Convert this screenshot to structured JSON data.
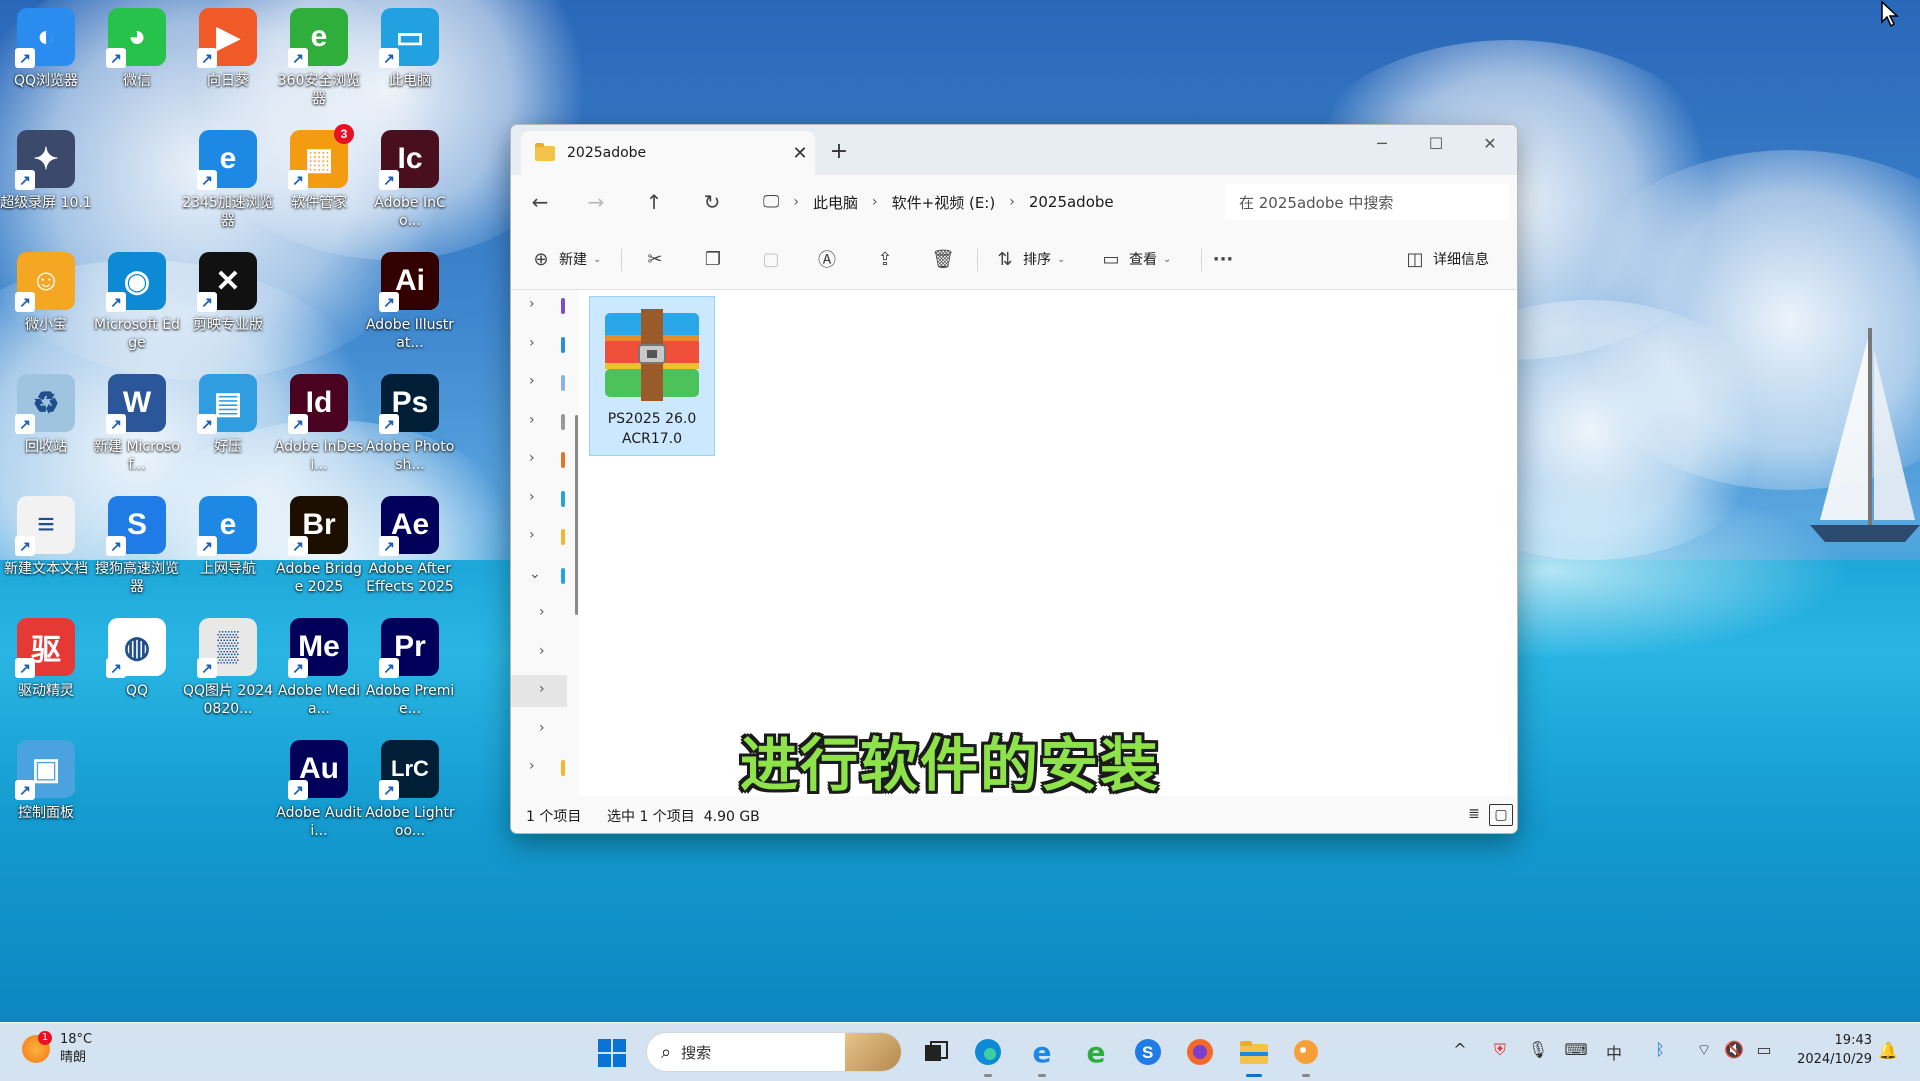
{
  "desktop": {
    "icons": [
      {
        "id": "qq-browser",
        "label": "QQ浏览器",
        "color": "#2b8cf0",
        "glyph": "◐",
        "badge": ""
      },
      {
        "id": "wechat",
        "label": "微信",
        "color": "#27c24c",
        "glyph": "◕",
        "badge": ""
      },
      {
        "id": "sunlogin",
        "label": "向日葵",
        "color": "#f05a28",
        "glyph": "▶",
        "badge": ""
      },
      {
        "id": "360-browser",
        "label": "360安全浏览器",
        "color": "#2fae3c",
        "glyph": "e",
        "badge": ""
      },
      {
        "id": "this-pc",
        "label": "此电脑",
        "color": "#21a1e0",
        "glyph": "▭",
        "badge": ""
      },
      {
        "id": "screen-recorder",
        "label": "超级录屏 10.1",
        "color": "#3b4a6b",
        "glyph": "✦",
        "badge": ""
      },
      {
        "id": "2345-browser",
        "label": "2345加速浏览器",
        "color": "#1e88e5",
        "glyph": "e",
        "badge": ""
      },
      {
        "id": "soft-manager",
        "label": "软件管家",
        "color": "#f39c12",
        "glyph": "▦",
        "badge": "3"
      },
      {
        "id": "adobe-incopy",
        "label": "Adobe InCo...",
        "color": "#4a0f1f",
        "glyph": "Ic",
        "badge": ""
      },
      {
        "id": "driver-wizard",
        "label": "微小宝",
        "color": "#f5a623",
        "glyph": "☺",
        "badge": ""
      },
      {
        "id": "ms-edge",
        "label": "Microsoft Edge",
        "color": "#0c8ad6",
        "glyph": "◉",
        "badge": ""
      },
      {
        "id": "capcut-pro",
        "label": "剪映专业版",
        "color": "#111111",
        "glyph": "✕",
        "badge": ""
      },
      {
        "id": "adobe-illustrator",
        "label": "Adobe Illustrat...",
        "color": "#330000",
        "glyph": "Ai",
        "badge": ""
      },
      {
        "id": "recycle-bin",
        "label": "回收站",
        "color": "#9fc4e0",
        "glyph": "♻",
        "badge": ""
      },
      {
        "id": "new-word",
        "label": "新建 Microsof...",
        "color": "#2b579a",
        "glyph": "W",
        "badge": ""
      },
      {
        "id": "haozip",
        "label": "好压",
        "color": "#2f9de0",
        "glyph": "▤",
        "badge": ""
      },
      {
        "id": "adobe-indesign-1",
        "label": "Adobe InDesi...",
        "color": "#49021f",
        "glyph": "Id",
        "badge": ""
      },
      {
        "id": "adobe-photoshop",
        "label": "Adobe Photosh...",
        "color": "#001e36",
        "glyph": "Ps",
        "badge": ""
      },
      {
        "id": "new-text",
        "label": "新建文本文档",
        "color": "#f2f2f2",
        "glyph": "≡",
        "badge": ""
      },
      {
        "id": "sogou-browser",
        "label": "搜狗高速浏览器",
        "color": "#1f7be6",
        "glyph": "S",
        "badge": ""
      },
      {
        "id": "web-nav",
        "label": "上网导航",
        "color": "#1e88e5",
        "glyph": "e",
        "badge": ""
      },
      {
        "id": "adobe-bridge",
        "label": "Adobe Bridge 2025",
        "color": "#1c0f00",
        "glyph": "Br",
        "badge": ""
      },
      {
        "id": "adobe-after-effects",
        "label": "Adobe After Effects 2025",
        "color": "#00005b",
        "glyph": "Ae",
        "badge": ""
      },
      {
        "id": "driver-genius",
        "label": "驱动精灵",
        "color": "#e53935",
        "glyph": "驱",
        "badge": ""
      },
      {
        "id": "qq",
        "label": "QQ",
        "color": "#ffffff",
        "glyph": "◍",
        "badge": ""
      },
      {
        "id": "qq-image",
        "label": "QQ图片 20240820...",
        "color": "#e8e8e8",
        "glyph": "▒",
        "badge": ""
      },
      {
        "id": "adobe-media-encoder",
        "label": "Adobe Media...",
        "color": "#00005b",
        "glyph": "Me",
        "badge": ""
      },
      {
        "id": "adobe-premiere",
        "label": "Adobe Premie...",
        "color": "#00005b",
        "glyph": "Pr",
        "badge": ""
      },
      {
        "id": "control-panel",
        "label": "控制面板",
        "color": "#4aa3df",
        "glyph": "▣",
        "badge": ""
      },
      {
        "id": "adobe-audition",
        "label": "Adobe Auditi...",
        "color": "#00005b",
        "glyph": "Au",
        "badge": ""
      },
      {
        "id": "adobe-lightroom",
        "label": "Adobe Lightroo...",
        "color": "#001e36",
        "glyph": "LrC",
        "badge": ""
      }
    ]
  },
  "explorer": {
    "tab_title": "2025adobe",
    "tab_close": "✕",
    "new_tab": "+",
    "controls": {
      "minimize": "─",
      "maximize": "☐",
      "close": "✕"
    },
    "breadcrumb": [
      "此电脑",
      "软件+视频 (E:)",
      "2025adobe"
    ],
    "search_placeholder": "在 2025adobe 中搜索",
    "commands": {
      "new_label": "新建",
      "sort_label": "排序",
      "view_label": "查看",
      "more": "···",
      "details_label": "详细信息"
    },
    "nav_tree": [
      {
        "chev": "›",
        "color": "#7a4fc9"
      },
      {
        "chev": "›",
        "color": "#2b8cd8"
      },
      {
        "chev": "›",
        "color": "#88b6e0"
      },
      {
        "chev": "›",
        "color": "#999999"
      },
      {
        "chev": "›",
        "color": "#e0762c"
      },
      {
        "chev": "›",
        "color": "#27a3d8"
      },
      {
        "chev": "›",
        "color": "#f2b632"
      },
      {
        "chev": "⌄",
        "color": "#27a3d8"
      },
      {
        "chev": "›",
        "color": ""
      },
      {
        "chev": "›",
        "color": ""
      },
      {
        "chev": "›",
        "color": ""
      },
      {
        "chev": "›",
        "color": ""
      },
      {
        "chev": "›",
        "color": "#f2b632"
      }
    ],
    "file": {
      "name_line1": "PS2025 26.0",
      "name_line2": "ACR17.0"
    },
    "status": {
      "items": "1 个项目",
      "selected": "选中 1 个项目  4.90 GB"
    }
  },
  "caption": "进行软件的安装",
  "taskbar": {
    "weather_temp": "18°C",
    "weather_desc": "晴朗",
    "weather_alert": "1",
    "search_placeholder": "搜索",
    "time": "19:43",
    "date": "2024/10/29"
  }
}
